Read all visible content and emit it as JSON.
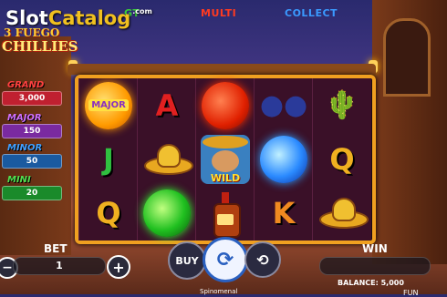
{
  "header": {
    "watermark_part1": "Slot",
    "watermark_part2": "Catalog",
    "watermark_suffix": ".com",
    "feature_labels": [
      {
        "text": "GT",
        "color": "#3ad03a"
      },
      {
        "text": "MULTI",
        "color": "#ff3a20"
      },
      {
        "text": "COLLECT",
        "color": "#3a9aff"
      }
    ]
  },
  "logo": {
    "line1": "3 FUEGO",
    "line2": "CHILLIES"
  },
  "jackpots": [
    {
      "label": "GRAND",
      "value": "3,000",
      "label_color": "#ff4040",
      "bar_color": "#c02030"
    },
    {
      "label": "MAJOR",
      "value": "150",
      "label_color": "#d070ff",
      "bar_color": "#7a2aa0"
    },
    {
      "label": "MINOR",
      "value": "50",
      "label_color": "#40a0ff",
      "bar_color": "#1a5aa0"
    },
    {
      "label": "MINI",
      "value": "20",
      "label_color": "#50e050",
      "bar_color": "#1a8a2a"
    }
  ],
  "reels": [
    [
      {
        "kind": "orb-orange",
        "text": "MAJOR"
      },
      {
        "kind": "letter",
        "text": "J",
        "color": "#30c040"
      },
      {
        "kind": "letter",
        "text": "Q",
        "color": "#f0b020"
      }
    ],
    [
      {
        "kind": "letter",
        "text": "A",
        "color": "#e02020"
      },
      {
        "kind": "sombrero",
        "text": ""
      },
      {
        "kind": "orb-green",
        "text": ""
      }
    ],
    [
      {
        "kind": "orb-red",
        "text": ""
      },
      {
        "kind": "wild",
        "text": "WILD"
      },
      {
        "kind": "bottle",
        "text": ""
      }
    ],
    [
      {
        "kind": "maracas",
        "text": "●●"
      },
      {
        "kind": "orb-blue",
        "text": ""
      },
      {
        "kind": "letter",
        "text": "K",
        "color": "#f08a20"
      }
    ],
    [
      {
        "kind": "cactus",
        "text": "🌵"
      },
      {
        "kind": "letter",
        "text": "Q",
        "color": "#f0b020"
      },
      {
        "kind": "sombrero",
        "text": ""
      }
    ]
  ],
  "controls": {
    "bet_label": "BET",
    "bet_value": "1",
    "minus": "−",
    "plus": "+",
    "buy_label": "BUY",
    "spin_icon": "⟳",
    "autoplay_icon": "⟲",
    "win_label": "WIN",
    "win_value": "",
    "balance": "BALANCE: 5,000",
    "mode": "FUN",
    "provider": "Spinomenal"
  }
}
